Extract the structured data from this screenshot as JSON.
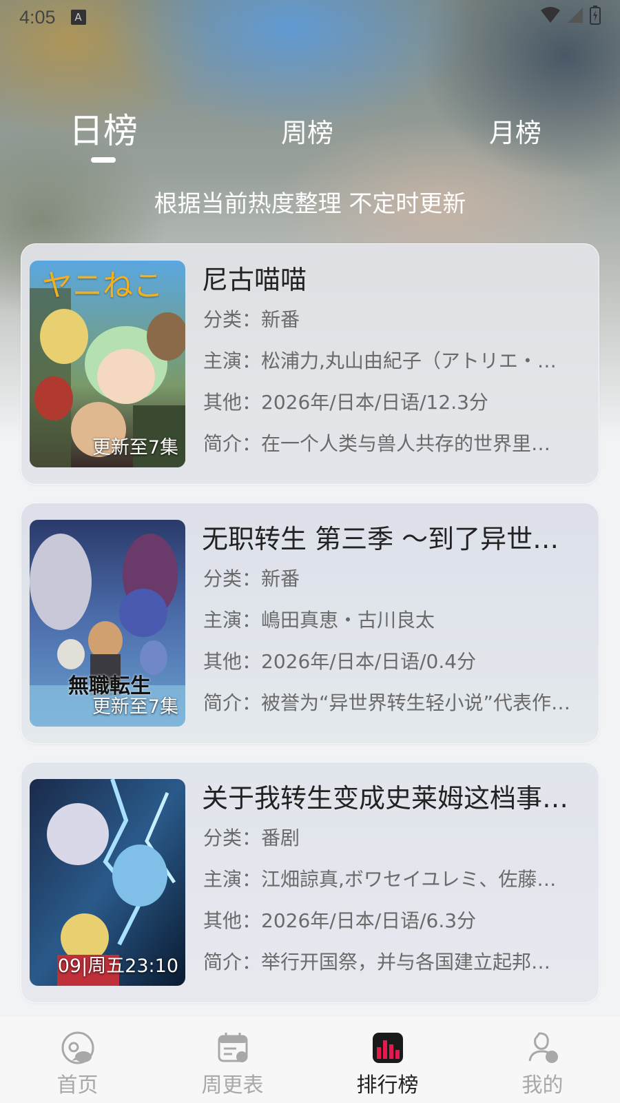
{
  "status_bar": {
    "time": "4:05",
    "notification_icon": "a-box-icon",
    "icons": [
      "wifi-icon",
      "signal-icon",
      "battery-icon"
    ]
  },
  "tabs": [
    {
      "label": "日榜",
      "active": true
    },
    {
      "label": "周榜",
      "active": false
    },
    {
      "label": "月榜",
      "active": false
    }
  ],
  "subtitle": "根据当前热度整理 不定时更新",
  "items": [
    {
      "title": "尼古喵喵",
      "category": "分类：新番",
      "cast": "主演：松浦力,丸山由紀子（アトリエ・…",
      "other": "其他：2026年/日本/日语/12.3分",
      "summary": "简介：在一个人类与兽人共存的世界里…",
      "badge": "更新至7集",
      "poster_logo": "ヤニねこ"
    },
    {
      "title": "无职转生 第三季 ～到了异世…",
      "category": "分类：新番",
      "cast": "主演：嶋田真恵・古川良太",
      "other": "其他：2026年/日本/日语/0.4分",
      "summary": "简介：被誉为“异世界转生轻小说”代表作…",
      "badge": "更新至7集",
      "poster_logo": "無職転生"
    },
    {
      "title": "关于我转生变成史莱姆这档事…",
      "category": "分类：番剧",
      "cast": "主演：江畑諒真,ボワセイユレミ、佐藤…",
      "other": "其他：2026年/日本/日语/6.3分",
      "summary": "简介：举行开国祭，并与各国建立起邦…",
      "badge": "09|周五23:10"
    }
  ],
  "bottom_nav": [
    {
      "label": "首页",
      "icon": "home-cat-icon",
      "active": false
    },
    {
      "label": "周更表",
      "icon": "calendar-icon",
      "active": false
    },
    {
      "label": "排行榜",
      "icon": "ranking-chart-icon",
      "active": true
    },
    {
      "label": "我的",
      "icon": "profile-icon",
      "active": false
    }
  ],
  "colors": {
    "accent": "#e8174e",
    "active_text": "#222222",
    "inactive_text": "#a8a8a8"
  }
}
